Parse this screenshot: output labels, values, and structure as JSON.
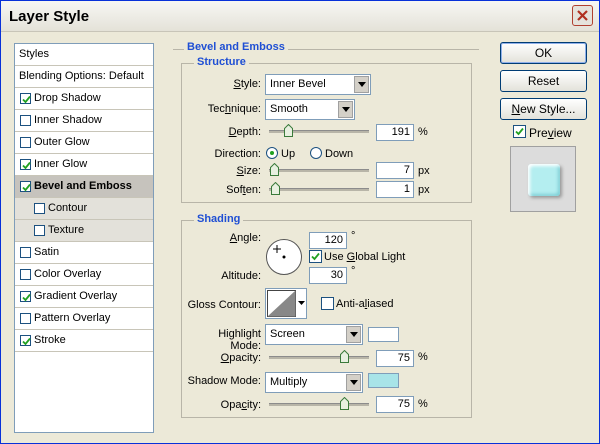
{
  "window": {
    "title": "Layer Style"
  },
  "styles_list": {
    "header": "Styles",
    "items": [
      {
        "label": "Blending Options: Default",
        "checkbox": false,
        "checked": false
      },
      {
        "label": "Drop Shadow",
        "checkbox": true,
        "checked": true
      },
      {
        "label": "Inner Shadow",
        "checkbox": true,
        "checked": false
      },
      {
        "label": "Outer Glow",
        "checkbox": true,
        "checked": false
      },
      {
        "label": "Inner Glow",
        "checkbox": true,
        "checked": true
      },
      {
        "label": "Bevel and Emboss",
        "checkbox": true,
        "checked": true,
        "selected": true
      },
      {
        "label": "Contour",
        "checkbox": true,
        "checked": false,
        "sub": true
      },
      {
        "label": "Texture",
        "checkbox": true,
        "checked": false,
        "sub": true
      },
      {
        "label": "Satin",
        "checkbox": true,
        "checked": false
      },
      {
        "label": "Color Overlay",
        "checkbox": true,
        "checked": false
      },
      {
        "label": "Gradient Overlay",
        "checkbox": true,
        "checked": true
      },
      {
        "label": "Pattern Overlay",
        "checkbox": true,
        "checked": false
      },
      {
        "label": "Stroke",
        "checkbox": true,
        "checked": true
      }
    ]
  },
  "bevel": {
    "title": "Bevel and Emboss",
    "structure": {
      "title": "Structure",
      "style_label": "Style:",
      "style_value": "Inner Bevel",
      "technique_label": "Technique:",
      "technique_value": "Smooth",
      "depth_label": "Depth:",
      "depth_value": "191",
      "depth_unit": "%",
      "depth_level": 0.191,
      "direction_label": "Direction:",
      "direction_up": "Up",
      "direction_down": "Down",
      "direction_selected": "Up",
      "size_label": "Size:",
      "size_value": "7",
      "size_unit": "px",
      "size_level": 0.05,
      "soften_label": "Soften:",
      "soften_value": "1",
      "soften_unit": "px",
      "soften_level": 0.06
    },
    "shading": {
      "title": "Shading",
      "angle_label": "Angle:",
      "angle_value": "120",
      "angle_unit": "°",
      "global_light_label": "Use Global Light",
      "global_light_checked": true,
      "altitude_label": "Altitude:",
      "altitude_value": "30",
      "altitude_unit": "°",
      "gloss_contour_label": "Gloss Contour:",
      "anti_aliased_label": "Anti-aliased",
      "anti_aliased_checked": false,
      "highlight_mode_label": "Highlight Mode:",
      "highlight_mode_value": "Screen",
      "highlight_color": "#ffffff",
      "highlight_opacity_label": "Opacity:",
      "highlight_opacity_value": "75",
      "highlight_opacity_unit": "%",
      "highlight_opacity_level": 0.75,
      "shadow_mode_label": "Shadow Mode:",
      "shadow_mode_value": "Multiply",
      "shadow_color": "#a8e4e8",
      "shadow_opacity_label": "Opacity:",
      "shadow_opacity_value": "75",
      "shadow_opacity_unit": "%",
      "shadow_opacity_level": 0.75
    }
  },
  "buttons": {
    "ok": "OK",
    "reset": "Reset",
    "new_style": "New Style...",
    "preview_label": "Preview",
    "preview_checked": true
  },
  "colors": {
    "group_title": "#1f4fd4",
    "preview_swatch": "#b4eef0"
  }
}
